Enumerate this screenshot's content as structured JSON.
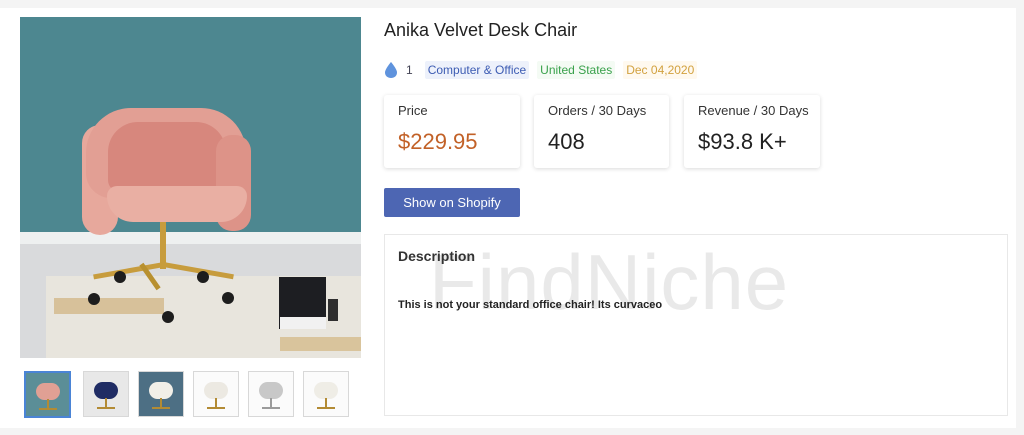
{
  "product": {
    "title": "Anika Velvet Desk Chair",
    "count": "1",
    "category": "Computer & Office",
    "country": "United States",
    "date": "Dec 04,2020"
  },
  "stats": {
    "price_label": "Price",
    "price_value": "$229.95",
    "orders_label": "Orders / 30 Days",
    "orders_value": "408",
    "revenue_label": "Revenue / 30 Days",
    "revenue_value": "$93.8 K+"
  },
  "actions": {
    "shopify_label": "Show on Shopify"
  },
  "description": {
    "heading": "Description",
    "text": "This is not your standard office chair! Its curvaceo",
    "watermark": "FindNiche"
  },
  "thumbnails": [
    {
      "name": "pink",
      "active": true
    },
    {
      "name": "navy",
      "active": false
    },
    {
      "name": "white-blue-wall",
      "active": false
    },
    {
      "name": "white-1",
      "active": false
    },
    {
      "name": "gray",
      "active": false
    },
    {
      "name": "white-2",
      "active": false
    }
  ],
  "colors": {
    "accent": "#4d66b3",
    "price": "#c26127",
    "category_tag": "#3d5cb3",
    "country_tag": "#39a14b",
    "date_tag": "#d2a13f"
  },
  "icons": {
    "meta": "water-drop-icon"
  }
}
